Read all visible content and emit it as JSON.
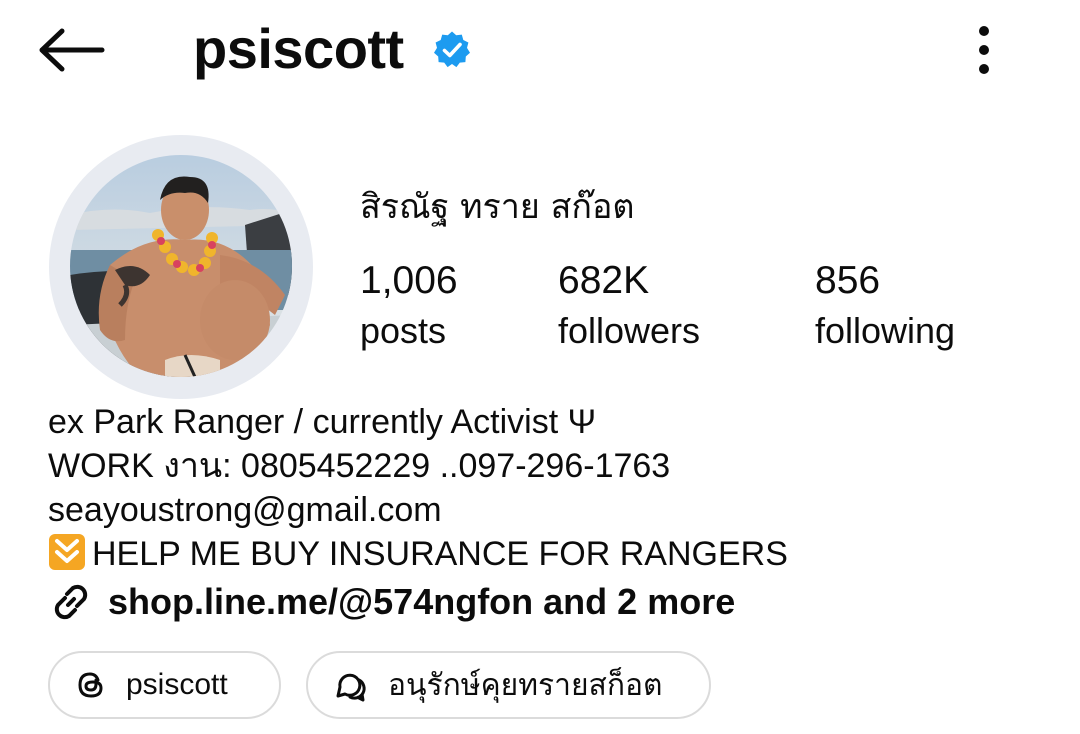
{
  "header": {
    "username": "psiscott",
    "back_icon": "arrow-left-icon",
    "verified_icon": "verified-badge-icon",
    "more_icon": "more-vertical-icon",
    "verified_color": "#1d9bf0"
  },
  "profile": {
    "display_name": "สิรณัฐ ทราย สก๊อต",
    "stats": [
      {
        "value": "1,006",
        "label": "posts"
      },
      {
        "value": "682K",
        "label": "followers"
      },
      {
        "value": "856",
        "label": "following"
      }
    ]
  },
  "bio": {
    "line1": "ex Park Ranger / currently Activist  Ψ",
    "line2": "WORK งาน: 0805452229 ..097-296-1763",
    "line3": "seayoustrong@gmail.com",
    "line4": "HELP ME BUY INSURANCE FOR RANGERS",
    "line4_icon": "double-arrow-down-emoji",
    "link_icon": "link-icon",
    "link_text": "shop.line.me/@574ngfon and 2 more"
  },
  "chips": {
    "threads": {
      "icon": "threads-icon",
      "label": "psiscott"
    },
    "group": {
      "icon": "chat-bubbles-icon",
      "label": "อนุรักษ์คุยทรายสก็อต"
    }
  }
}
